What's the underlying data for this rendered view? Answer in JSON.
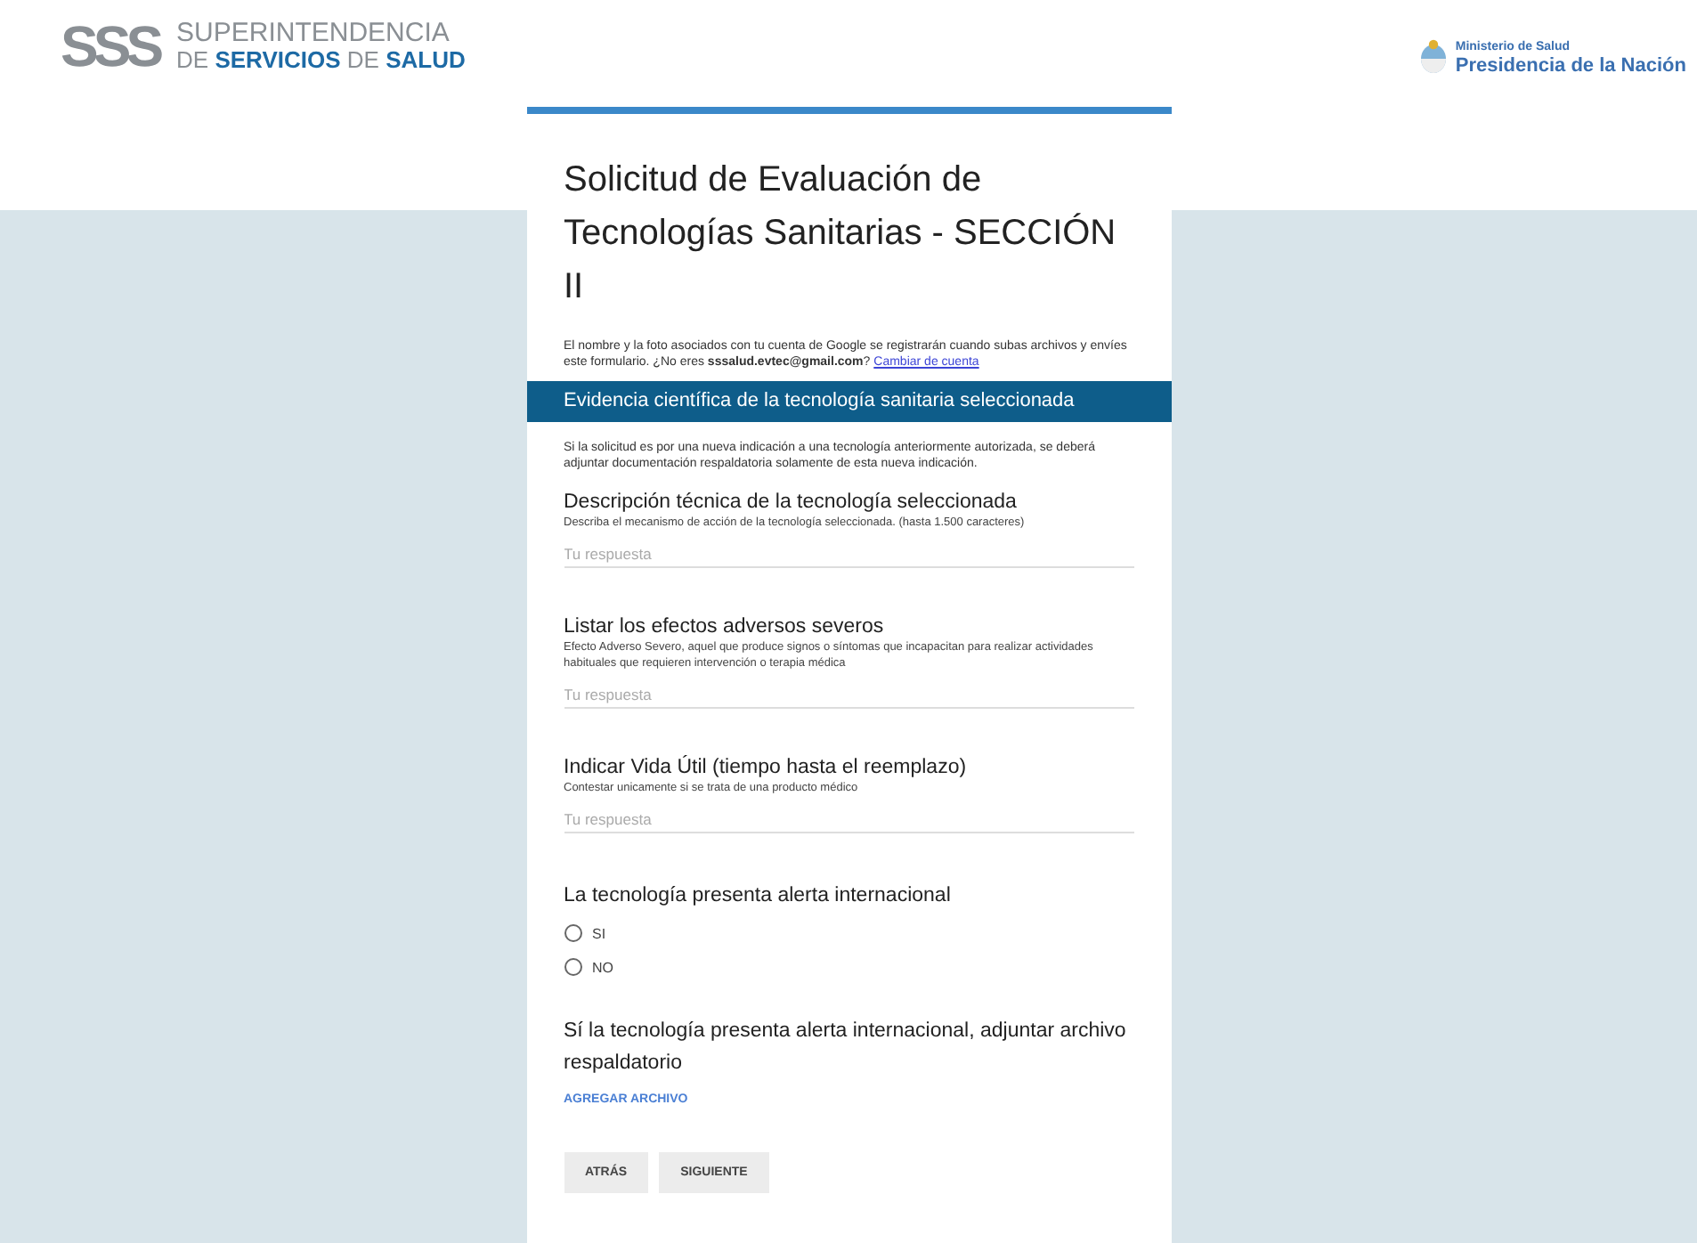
{
  "header": {
    "logo_mark": "SSS",
    "logo_line_1": "SUPERINTENDENCIA",
    "logo_line_2": "DE **SERVICIOS** DE **SALUD**",
    "ministry_small": "Ministerio de Salud",
    "ministry_large": "Presidencia de la Nación"
  },
  "form": {
    "title": "Solicitud de Evaluación de Tecnologías Sanitarias - SECCIÓN II",
    "account_notice": "El nombre y la foto asociados con tu cuenta de Google se registrarán cuando subas archivos y envíes este formulario. ¿No eres **sssalud.evtec@gmail.com**?",
    "account_link": "Cambiar de cuenta",
    "section_title": "Evidencia científica de la tecnología sanitaria seleccionada",
    "section_description": "Si la solicitud es por una nueva indicación a una tecnología anteriormente autorizada, se deberá adjuntar documentación respaldatoria solamente de esta nueva indicación.",
    "questions": [
      {
        "kind": "text",
        "title": "Descripción técnica de la tecnología seleccionada",
        "help": "Describa el mecanismo de acción de la tecnología seleccionada. (hasta 1.500 caracteres)",
        "placeholder": "Tu respuesta"
      },
      {
        "kind": "text",
        "title": "Listar los efectos adversos severos",
        "help": "Efecto Adverso Severo, aquel que produce signos o síntomas que incapacitan para realizar actividades habituales que requieren intervención o terapia médica",
        "placeholder": "Tu respuesta"
      },
      {
        "kind": "text",
        "title": "Indicar Vida Útil (tiempo hasta el reemplazo)",
        "help": "Contestar unicamente si se trata de una producto médico",
        "placeholder": "Tu respuesta"
      },
      {
        "kind": "radio",
        "title": "La tecnología presenta alerta internacional",
        "options": [
          {
            "label": "SI",
            "selected": false
          },
          {
            "label": "NO",
            "selected": false
          }
        ]
      },
      {
        "kind": "file",
        "title": "Sí la tecnología presenta alerta internacional, adjuntar archivo respaldatorio",
        "button": "AGREGAR ARCHIVO"
      }
    ],
    "buttons": [
      "ATRÁS",
      "SIGUIENTE"
    ]
  }
}
